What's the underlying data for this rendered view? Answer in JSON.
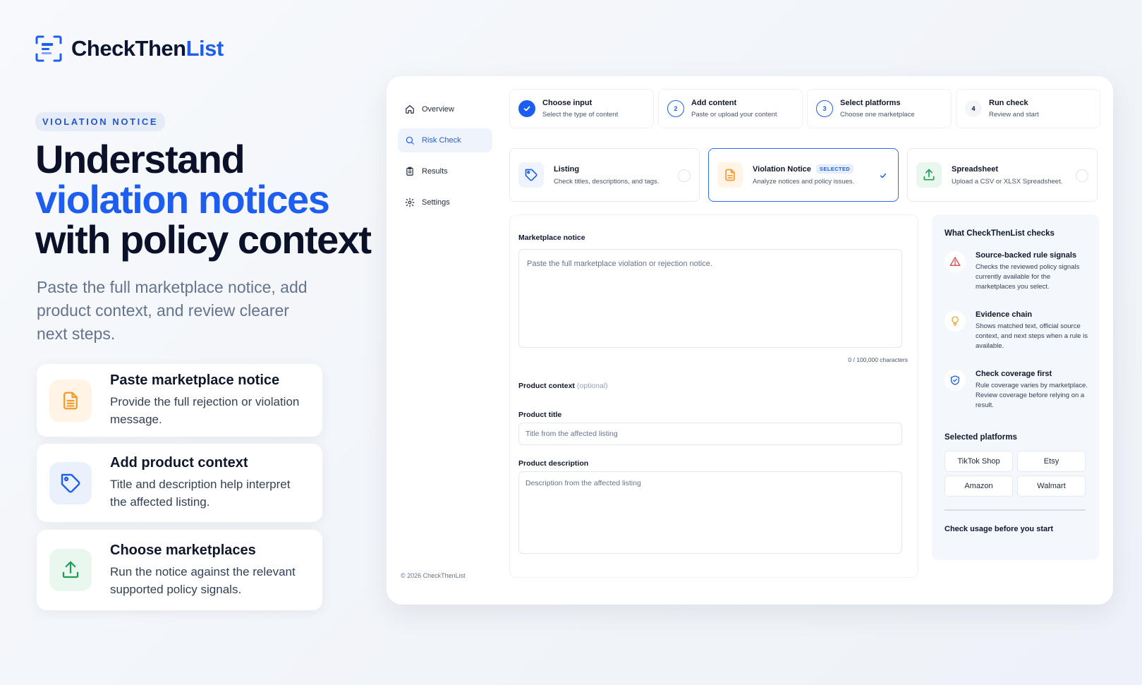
{
  "brand": {
    "name_primary": "CheckThen",
    "name_accent": "List",
    "color_accent": "#1d5ef0"
  },
  "hero": {
    "eyebrow": "VIOLATION NOTICE",
    "headline_line1": "Understand",
    "headline_line2": "violation notices",
    "headline_line3": "with policy context",
    "subtext": "Paste the full marketplace notice, add product context, and review clearer next steps."
  },
  "features": [
    {
      "icon": "document-icon",
      "title": "Paste marketplace notice",
      "desc": "Provide the full rejection or violation message."
    },
    {
      "icon": "tag-icon",
      "title": "Add product context",
      "desc": "Title and description help interpret the affected listing."
    },
    {
      "icon": "upload-icon",
      "title": "Choose marketplaces",
      "desc": "Run the notice against the relevant supported policy signals."
    }
  ],
  "nav": {
    "items": [
      {
        "label": "Overview",
        "icon": "home-icon"
      },
      {
        "label": "Risk Check",
        "icon": "search-icon"
      },
      {
        "label": "Results",
        "icon": "clipboard-icon"
      },
      {
        "label": "Settings",
        "icon": "gear-icon"
      }
    ],
    "copyright": "© 2026 CheckThenList"
  },
  "steps": [
    {
      "num": "",
      "title": "Choose input",
      "desc": "Select the type of content",
      "state": "done"
    },
    {
      "num": "2",
      "title": "Add content",
      "desc": "Paste or upload your content",
      "state": "active"
    },
    {
      "num": "3",
      "title": "Select platforms",
      "desc": "Choose one marketplace",
      "state": "active"
    },
    {
      "num": "4",
      "title": "Run check",
      "desc": "Review and start",
      "state": "plain"
    }
  ],
  "input_types": [
    {
      "title": "Listing",
      "desc": "Check titles, descriptions, and tags.",
      "icon": "tag-icon"
    },
    {
      "title": "Violation Notice",
      "badge": "SELECTED",
      "desc": "Analyze notices and policy issues.",
      "icon": "document-icon"
    },
    {
      "title": "Spreadsheet",
      "desc": "Upload a CSV or XLSX Spreadsheet.",
      "icon": "upload-icon"
    }
  ],
  "form": {
    "notice_label": "Marketplace notice",
    "notice_placeholder": "Paste the full marketplace violation or rejection notice.",
    "counter": "0 / 100,000 characters",
    "context_label": "Product context",
    "context_optional": "(optional)",
    "title_label": "Product title",
    "title_placeholder": "Title from the affected listing",
    "desc_label": "Product description",
    "desc_placeholder": "Description from the affected listing"
  },
  "side": {
    "title": "What CheckThenList checks",
    "checks": [
      {
        "icon": "warning-icon",
        "title": "Source-backed rule signals",
        "desc": "Checks the reviewed policy signals currently available for the marketplaces you select."
      },
      {
        "icon": "lightbulb-icon",
        "title": "Evidence chain",
        "desc": "Shows matched text, official source context, and next steps when a rule is available."
      },
      {
        "icon": "shield-check-icon",
        "title": "Check coverage first",
        "desc": "Rule coverage varies by marketplace. Review coverage before relying on a result."
      }
    ],
    "platforms_title": "Selected platforms",
    "platforms": [
      "TikTok Shop",
      "Etsy",
      "Amazon",
      "Walmart"
    ],
    "usage": "Check usage before you start"
  }
}
